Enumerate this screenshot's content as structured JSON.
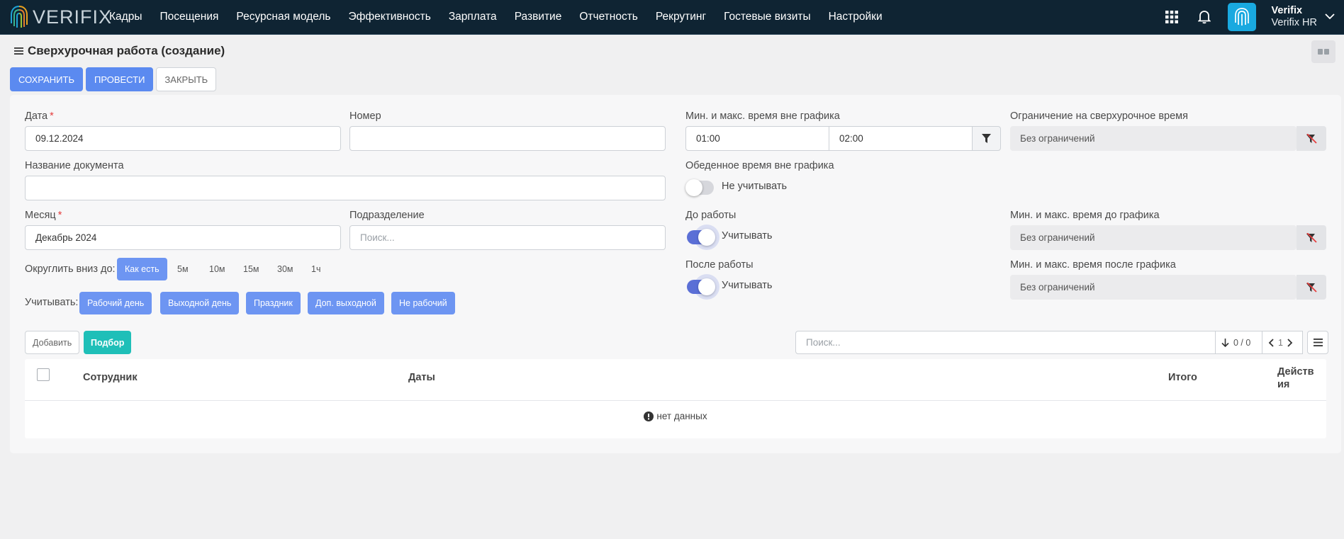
{
  "brand": {
    "logo_text": "VERIFIX"
  },
  "nav": [
    "Кадры",
    "Посещения",
    "Ресурсная модель",
    "Эффективность",
    "Зарплата",
    "Развитие",
    "Отчетность",
    "Рекрутинг",
    "Гостевые визиты",
    "Настройки"
  ],
  "user": {
    "name": "Verifix",
    "org": "Verifix HR"
  },
  "page": {
    "title": "Сверхурочная работа (создание)"
  },
  "actions": {
    "save": "СОХРАНИТЬ",
    "post": "ПРОВЕСТИ",
    "close": "ЗАКРЫТЬ"
  },
  "form": {
    "date": {
      "label": "Дата",
      "value": "09.12.2024"
    },
    "number": {
      "label": "Номер",
      "value": ""
    },
    "doc_name": {
      "label": "Название документа",
      "value": ""
    },
    "month": {
      "label": "Месяц",
      "value": "Декабрь 2024"
    },
    "division": {
      "label": "Подразделение",
      "placeholder": "Поиск..."
    },
    "round_down": {
      "label": "Округлить вниз до:",
      "options": [
        "Как есть",
        "5м",
        "10м",
        "15м",
        "30м",
        "1ч"
      ],
      "selected": "Как есть"
    },
    "consider": {
      "label": "Учитывать:",
      "options": [
        "Рабочий день",
        "Выходной день",
        "Праздник",
        "Доп. выходной",
        "Не рабочий"
      ]
    },
    "offschedule": {
      "label": "Мин. и макс. время вне графика",
      "min": "01:00",
      "max": "02:00"
    },
    "overtime_limit": {
      "label": "Ограничение на сверхурочное время",
      "value": "Без ограничений"
    },
    "lunch": {
      "label": "Обеденное время вне графика",
      "toggle_label": "Не учитывать",
      "on": false
    },
    "before": {
      "label": "До работы",
      "toggle_label": "Учитывать",
      "on": true
    },
    "before_limit": {
      "label": "Мин. и макс. время до графика",
      "value": "Без ограничений"
    },
    "after": {
      "label": "После работы",
      "toggle_label": "Учитывать",
      "on": true
    },
    "after_limit": {
      "label": "Мин. и макс. время после графика",
      "value": "Без ограничений"
    }
  },
  "table_toolbar": {
    "add": "Добавить",
    "pick": "Подбор",
    "search_placeholder": "Поиск...",
    "count": "0 / 0",
    "page": "1"
  },
  "table": {
    "columns": [
      "Сотрудник",
      "Даты",
      "Итого",
      "Действия"
    ],
    "actions_col_line1": "Действ",
    "actions_col_line2": "ия",
    "empty": "нет данных"
  },
  "colors": {
    "primary": "#5b8af0",
    "teal": "#1fbfb8",
    "topbar": "#0f2433",
    "toggle_on": "#5b6fd6"
  }
}
